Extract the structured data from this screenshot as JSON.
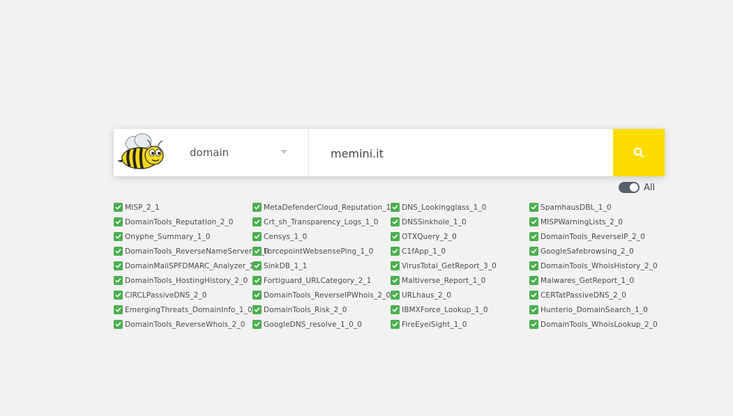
{
  "search": {
    "observable_type": "domain",
    "query_value": "memini.it",
    "accent_color": "#fddc00"
  },
  "toggle": {
    "label": "All",
    "checked": true
  },
  "analyzers": {
    "columns": [
      [
        {
          "label": "MISP_2_1",
          "checked": true
        },
        {
          "label": "DomainTools_Reputation_2_0",
          "checked": true
        },
        {
          "label": "Onyphe_Summary_1_0",
          "checked": true
        },
        {
          "label": "DomainTools_ReverseNameServer_2_0",
          "checked": true
        },
        {
          "label": "DomainMailSPFDMARC_Analyzer_1_1",
          "checked": true
        },
        {
          "label": "DomainTools_HostingHistory_2_0",
          "checked": true
        },
        {
          "label": "CIRCLPassiveDNS_2_0",
          "checked": true
        },
        {
          "label": "EmergingThreats_DomainInfo_1_0",
          "checked": true
        },
        {
          "label": "DomainTools_ReverseWhois_2_0",
          "checked": true
        }
      ],
      [
        {
          "label": "MetaDefenderCloud_Reputation_1_0",
          "checked": true
        },
        {
          "label": "Crt_sh_Transparency_Logs_1_0",
          "checked": true
        },
        {
          "label": "Censys_1_0",
          "checked": true
        },
        {
          "label": "ForcepointWebsensePing_1_0",
          "checked": true
        },
        {
          "label": "SinkDB_1_1",
          "checked": true
        },
        {
          "label": "Fortiguard_URLCategory_2_1",
          "checked": true
        },
        {
          "label": "DomainTools_ReverseIPWhois_2_0",
          "checked": true
        },
        {
          "label": "DomainTools_Risk_2_0",
          "checked": true
        },
        {
          "label": "GoogleDNS_resolve_1_0_0",
          "checked": true
        }
      ],
      [
        {
          "label": "DNS_Lookingglass_1_0",
          "checked": true
        },
        {
          "label": "DNSSinkhole_1_0",
          "checked": true
        },
        {
          "label": "OTXQuery_2_0",
          "checked": true
        },
        {
          "label": "C1fApp_1_0",
          "checked": true
        },
        {
          "label": "VirusTotal_GetReport_3_0",
          "checked": true
        },
        {
          "label": "Maltiverse_Report_1_0",
          "checked": true
        },
        {
          "label": "URLhaus_2_0",
          "checked": true
        },
        {
          "label": "IBMXForce_Lookup_1_0",
          "checked": true
        },
        {
          "label": "FireEyeiSight_1_0",
          "checked": true
        }
      ],
      [
        {
          "label": "SpamhausDBL_1_0",
          "checked": true
        },
        {
          "label": "MISPWarningLists_2_0",
          "checked": true
        },
        {
          "label": "DomainTools_ReverseIP_2_0",
          "checked": true
        },
        {
          "label": "GoogleSafebrowsing_2_0",
          "checked": true
        },
        {
          "label": "DomainTools_WhoisHistory_2_0",
          "checked": true
        },
        {
          "label": "Malwares_GetReport_1_0",
          "checked": true
        },
        {
          "label": "CERTatPassiveDNS_2_0",
          "checked": true
        },
        {
          "label": "Hunterio_DomainSearch_1_0",
          "checked": true
        },
        {
          "label": "DomainTools_WhoisLookup_2_0",
          "checked": true
        }
      ]
    ],
    "checkbox_color": "#4caf50"
  },
  "icons": {
    "logo": "bee-logo-icon",
    "search": "search-icon",
    "caret": "chevron-down-icon",
    "checkbox": "checkbox-checked-icon"
  }
}
